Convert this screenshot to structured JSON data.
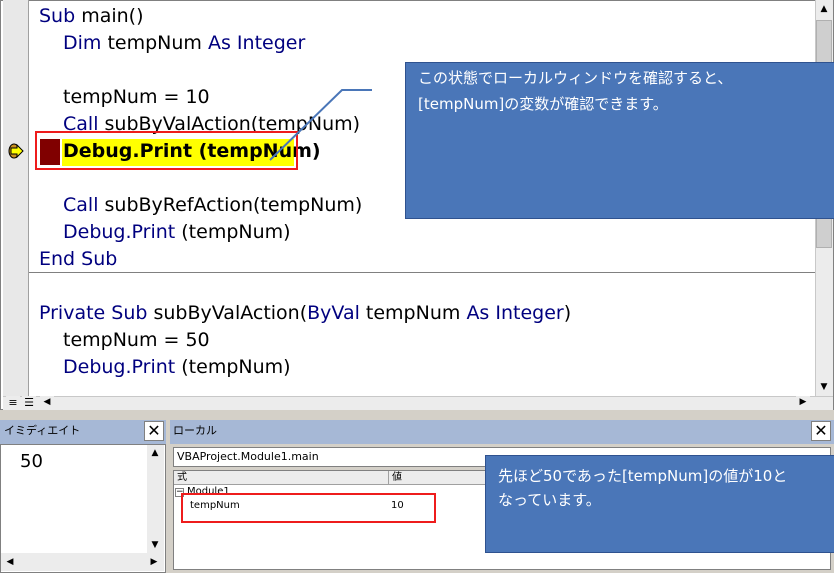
{
  "code_window": {
    "lines": {
      "l1": {
        "kw1": "Sub",
        "rest": " main()"
      },
      "l2": {
        "kw1": "Dim",
        "mid": " tempNum ",
        "kw2": "As Integer"
      },
      "l4": {
        "text": "tempNum = 10"
      },
      "l5": {
        "kw1": "Call",
        "rest": " subByValAction(tempNum)"
      },
      "l6": {
        "text": "Debug.Print (tempNum)"
      },
      "l8": {
        "kw1": "Call",
        "rest": " subByRefAction(tempNum)"
      },
      "l9": {
        "kw1": "Debug.Print",
        "rest": " (tempNum)"
      },
      "l10": {
        "kw1": "End Sub"
      },
      "l12": {
        "kw1": "Private Sub",
        "mid1": " subByValAction(",
        "kw2": "ByVal",
        "mid2": " tempNum ",
        "kw3": "As Integer",
        "end": ")"
      },
      "l13": {
        "text": "tempNum = 50"
      },
      "l14": {
        "kw1": "Debug.Print",
        "rest": " (tempNum)"
      }
    }
  },
  "callouts": {
    "top": {
      "line1": "この状態でローカルウィンドウを確認すると、",
      "line2": "[tempNum]の変数が確認できます。"
    },
    "bottom": {
      "line1": "先ほど50であった[tempNum]の値が10と",
      "line2": "なっています。"
    }
  },
  "immediate": {
    "title": "イミディエイト",
    "output": "50"
  },
  "locals": {
    "title": "ローカル",
    "context": "VBAProject.Module1.main",
    "col_expr": "式",
    "col_value": "値",
    "module_row": "Module1",
    "var_name": "tempNum",
    "var_value": "10"
  },
  "colors": {
    "keyword": "#00007f",
    "highlight": "#ffff00",
    "callout": "#4a76b8",
    "annotation_red": "#ee1c1c"
  }
}
